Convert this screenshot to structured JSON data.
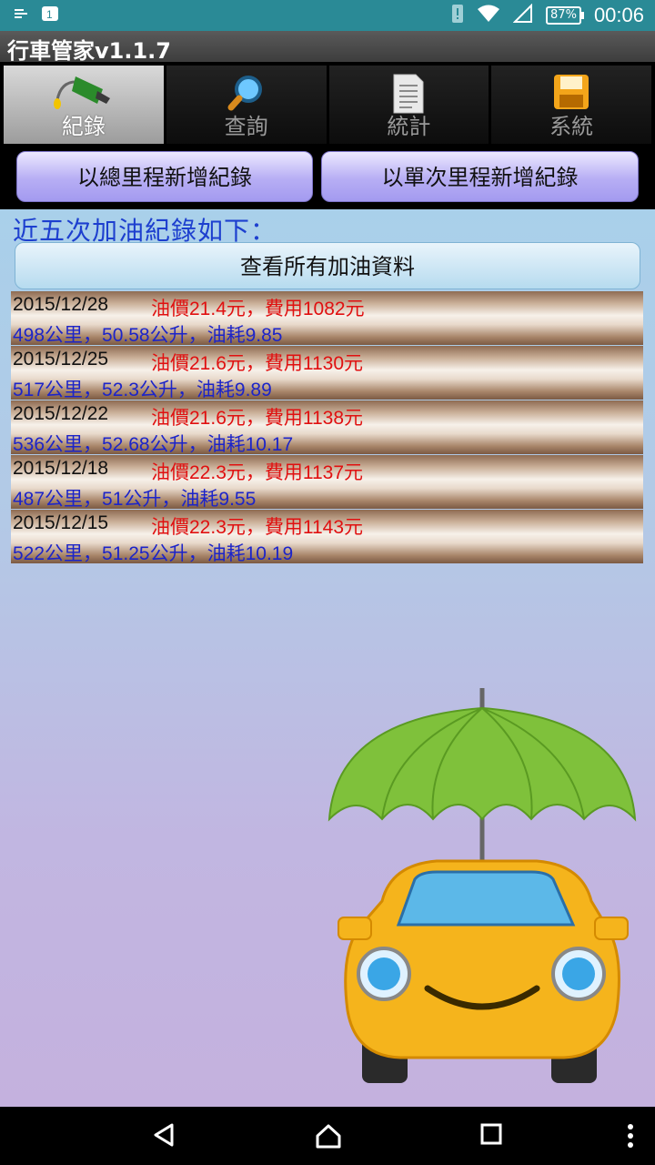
{
  "status_bar": {
    "time": "00:06",
    "battery": "87%"
  },
  "app": {
    "title": "行車管家v1.1.7"
  },
  "tabs": [
    {
      "label": "紀錄",
      "icon": "fuel-nozzle-icon",
      "active": true
    },
    {
      "label": "查詢",
      "icon": "magnifier-icon",
      "active": false
    },
    {
      "label": "統計",
      "icon": "document-icon",
      "active": false
    },
    {
      "label": "系統",
      "icon": "floppy-disk-icon",
      "active": false
    }
  ],
  "buttons": {
    "add_total": "以總里程新增紀錄",
    "add_trip": "以單次里程新增紀錄",
    "view_all": "查看所有加油資料"
  },
  "heading": "近五次加油紀錄如下：",
  "records": [
    {
      "date": "2015/12/28",
      "price": "油價21.4元，費用1082元",
      "detail": "498公里，50.58公升，油耗9.85"
    },
    {
      "date": "2015/12/25",
      "price": "油價21.6元，費用1130元",
      "detail": "517公里，52.3公升，油耗9.89"
    },
    {
      "date": "2015/12/22",
      "price": "油價21.6元，費用1138元",
      "detail": "536公里，52.68公升，油耗10.17"
    },
    {
      "date": "2015/12/18",
      "price": "油價22.3元，費用1137元",
      "detail": "487公里，51公升，油耗9.55"
    },
    {
      "date": "2015/12/15",
      "price": "油價22.3元，費用1143元",
      "detail": "522公里，51.25公升，油耗10.19"
    }
  ],
  "colors": {
    "price_text": "#e01010",
    "detail_text": "#1c24c9",
    "heading_text": "#1d3fcf"
  }
}
